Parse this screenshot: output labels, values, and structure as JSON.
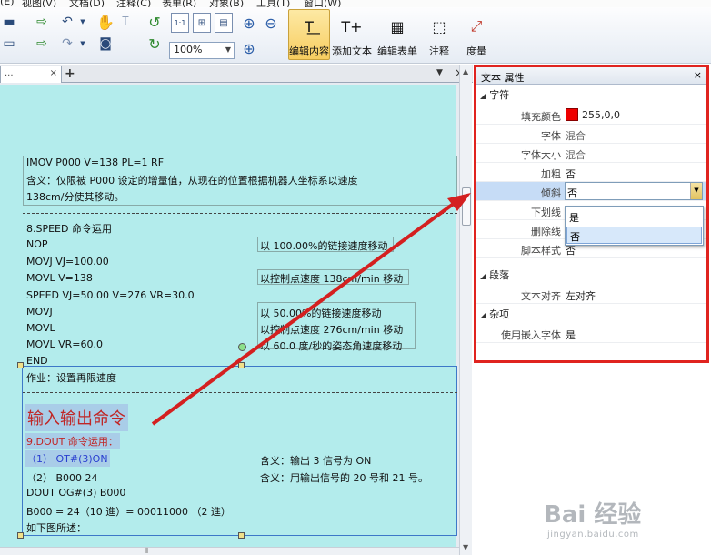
{
  "menubar": {
    "items": [
      "(E)",
      "视图(V)",
      "文档(D)",
      "注释(C)",
      "表单(R)",
      "对象(B)",
      "工具(T)",
      "窗口(W)"
    ]
  },
  "toolbar": {
    "zoom_value": "100%",
    "edit_content": "编辑内容",
    "add_text": "添加文本",
    "edit_form": "编辑表单",
    "annotation": "注释",
    "measure": "度量",
    "zoom_1to1": "1:1"
  },
  "tabs": {
    "doc_tab": "...",
    "close": "×",
    "add": "+",
    "drop": "▼",
    "close_doc": "×"
  },
  "document": {
    "lines": {
      "l1": "IMOV P000 V=138 PL=1 RF",
      "l2": "含义：仅限被 P000 设定的增量值，从现在的位置根据机器人坐标系以速度",
      "l3": "138cm/分使其移动。",
      "l4": "8.SPEED 命令运用",
      "l5": "NOP",
      "l6": "MOVJ VJ=100.00",
      "l7": "MOVL V=138",
      "l8": "SPEED VJ=50.00 V=276 VR=30.0",
      "l9": "MOVJ",
      "l10": "MOVL",
      "l11": "MOVL VR=60.0",
      "l12": "END",
      "l13": "作业：设置再限速度",
      "heading": "输入输出命令",
      "l14": "9.DOUT  命令运用：",
      "l15": "（1）  OT#(3)ON",
      "l16": "（2）  B000 24",
      "l17": "DOUT OG#(3) B000",
      "l18": "B000 = 24（10 進）= 00011000  （2  進）",
      "l19": "如下图所述："
    },
    "notes": {
      "n1": "以 100.00%的链接速度移动",
      "n2": "以控制点速度 138cm/min 移动",
      "n3": "以 50.00%的链接速度移动",
      "n4": "以控制点速度 276cm/min 移动",
      "n5": "以 60.0 度/秒的姿态角速度移动",
      "n6": "含义：输出 3 信号为 ON",
      "n7": "含义：用输出信号的 20 号和 21 号。"
    }
  },
  "panel": {
    "title": "文本 属性",
    "close": "×",
    "cat_char": "字符",
    "cat_para": "段落",
    "cat_misc": "杂项",
    "rows": {
      "fill_color": {
        "label": "填充颜色",
        "value": "255,0,0"
      },
      "font": {
        "label": "字体",
        "value": "混合"
      },
      "font_size": {
        "label": "字体大小",
        "value": "混合"
      },
      "bold": {
        "label": "加粗",
        "value": "否"
      },
      "italic": {
        "label": "倾斜",
        "value": "否"
      },
      "underline": {
        "label": "下划线",
        "value": ""
      },
      "strike": {
        "label": "删除线",
        "value": ""
      },
      "script": {
        "label": "脚本样式",
        "value": "否"
      },
      "align": {
        "label": "文本对齐",
        "value": "左对齐"
      },
      "embed_font": {
        "label": "使用嵌入字体",
        "value": "是"
      }
    },
    "dropdown": {
      "options": [
        "是",
        "否"
      ],
      "selected": "否"
    }
  },
  "colors": {
    "fill_swatch": "#e00000",
    "panel_border": "#e0231f",
    "page_bg": "#b3ecec",
    "arrow": "#d42020"
  },
  "watermark": {
    "logo": "Bai 经验",
    "url": "jingyan.baidu.com"
  }
}
